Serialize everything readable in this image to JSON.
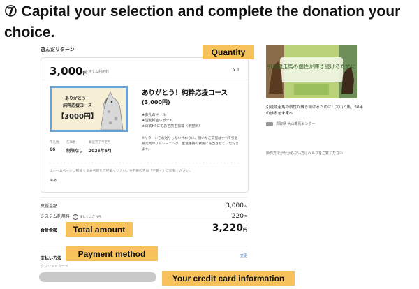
{
  "heading": "⑦ Capital your selection and complete the donation your choice.",
  "selection": {
    "section_title": "選んだリターン",
    "price": "3,000",
    "yen": "円",
    "price_note": "+システム利用料",
    "quantity": "x 1",
    "thumbnail": {
      "line1": "ありがとう！",
      "line2": "純粋応援コース",
      "line3": "【3000円】"
    },
    "meta": {
      "labels": [
        "申込数",
        "在庫数",
        "発送完了予定月"
      ],
      "values": [
        "66",
        "制限なし",
        "2026年6月"
      ]
    },
    "title": "ありがとう！純粋応援コース",
    "title_price": "(3,000円)",
    "items": [
      "★お礼のメール",
      "★活動報告レポート",
      "★公式HPにてお名前を掲載（希望制）"
    ],
    "note": "※リターンをお送りしない代わりに、頂いたご支援はすべて引退競走馬のリトレーニング、生活維持の費用に充当させていただきます。",
    "comment_note": "①ホームページに掲載するお名前をご記載ください。※不要の方は「不要」とご記載ください。",
    "comment_value": "ああ"
  },
  "totals": {
    "support_label": "支援金額",
    "support_value": "3,000",
    "system_label": "システム利用料",
    "system_guide": "詳しくはこちら",
    "system_value": "220",
    "total_label": "合計金額",
    "total_value": "3,220",
    "yen": "円"
  },
  "payment": {
    "label": "支払い方法",
    "change": "変更",
    "method": "クレジットカード"
  },
  "project": {
    "banner_text": "引退競走馬の個性が輝き続けるために",
    "description": "引退競走馬の個性が輝き続けるために！大山と馬、50年の歩みを未来へ",
    "organizer": "鳥取県 大山乗馬センター",
    "help": "操作方法が分からない方はヘルプをご覧ください"
  },
  "annotations": {
    "quantity": "Quantity",
    "total_amount": "Total amount",
    "payment_method": "Payment method",
    "credit_card": "Your credit card information"
  },
  "colors": {
    "annotation_tag": "#f7c25c",
    "thumbnail_border": "#6aa3cf",
    "link": "#3a7bd5"
  }
}
